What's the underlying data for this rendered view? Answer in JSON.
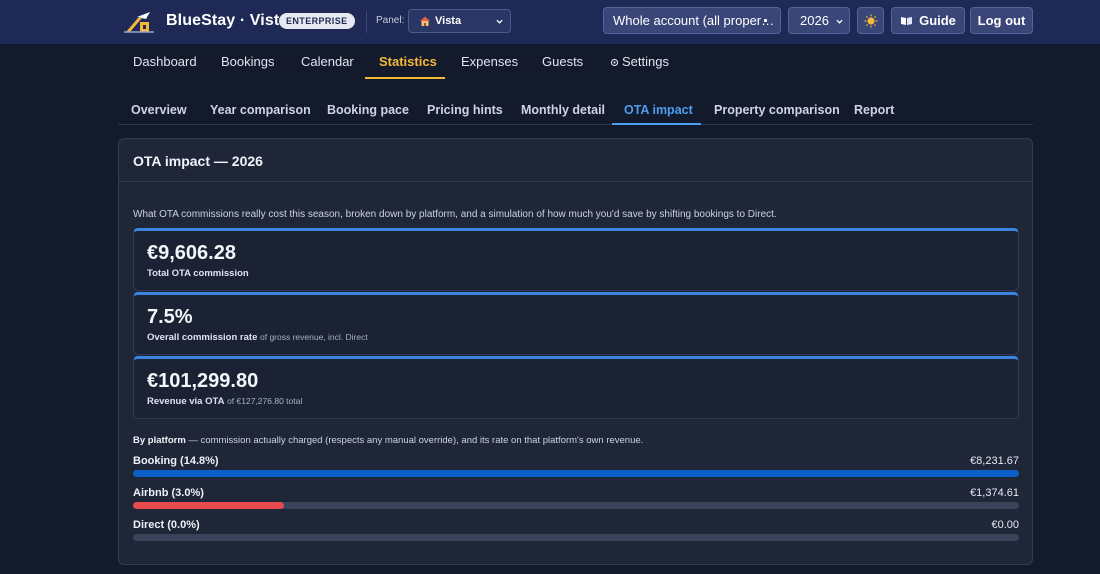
{
  "header": {
    "brand": "BlueStay · Vista",
    "plan_badge": "ENTERPRISE",
    "panel_label": "Panel:",
    "panel_value": "Vista",
    "account_select": "Whole account (all proper…",
    "year_select": "2026",
    "guide_label": "Guide",
    "logout_label": "Log out"
  },
  "main_nav": [
    {
      "label": "Dashboard"
    },
    {
      "label": "Bookings"
    },
    {
      "label": "Calendar"
    },
    {
      "label": "Statistics",
      "active": true
    },
    {
      "label": "Expenses"
    },
    {
      "label": "Guests"
    },
    {
      "label": "Settings"
    }
  ],
  "sub_nav": [
    {
      "label": "Overview"
    },
    {
      "label": "Year comparison"
    },
    {
      "label": "Booking pace"
    },
    {
      "label": "Pricing hints"
    },
    {
      "label": "Monthly detail"
    },
    {
      "label": "OTA impact",
      "active": true
    },
    {
      "label": "Property comparison"
    },
    {
      "label": "Report"
    }
  ],
  "card": {
    "title": "OTA impact — 2026",
    "intro": "What OTA commissions really cost this season, broken down by platform, and a simulation of how much you'd save by shifting bookings to Direct.",
    "kpis": [
      {
        "value": "€9,606.28",
        "label": "Total OTA commission",
        "sub": ""
      },
      {
        "value": "7.5%",
        "label": "Overall commission rate",
        "sub": "of gross revenue, incl. Direct"
      },
      {
        "value": "€101,299.80",
        "label": "Revenue via OTA",
        "sub": "of €127,276.80 total"
      }
    ],
    "by_platform_title": "By platform",
    "by_platform_desc": " — commission actually charged (respects any manual override), and its rate on that platform's own revenue.",
    "platforms": [
      {
        "name": "Booking (14.8%)",
        "amount": "€8,231.67",
        "share": 1.0,
        "color": "#0b5fc7"
      },
      {
        "name": "Airbnb (3.0%)",
        "amount": "€1,374.61",
        "share": 0.17,
        "color": "#e84b4f"
      },
      {
        "name": "Direct (0.0%)",
        "amount": "€0.00",
        "share": 0.0,
        "color": "#3b86e0"
      }
    ]
  },
  "colors": {
    "topbar": "#1e2a55",
    "accent_main": "#f5b93a",
    "accent_sub": "#4d9df0"
  }
}
